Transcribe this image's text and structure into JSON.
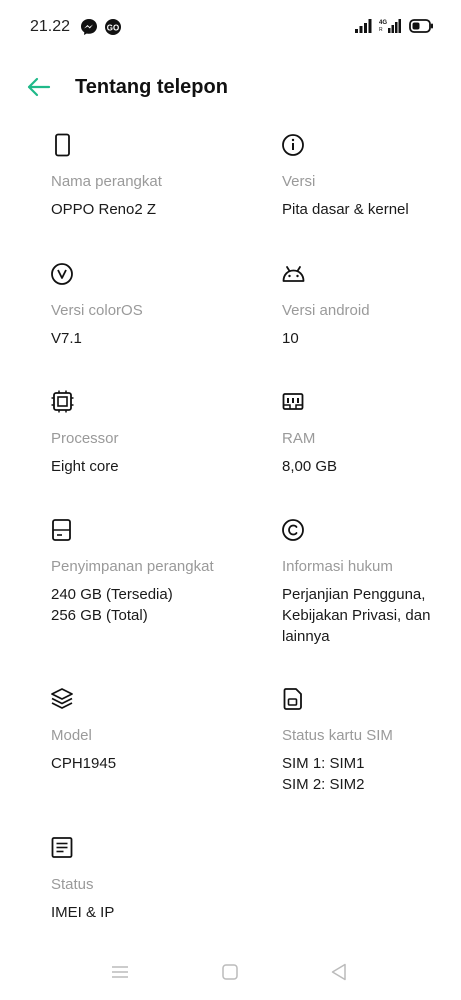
{
  "status_bar": {
    "time": "21.22",
    "left_icons": [
      "messenger-icon",
      "game-controller-icon"
    ],
    "right_icons": [
      "signal-icon",
      "4g-signal-icon",
      "battery-icon"
    ]
  },
  "header": {
    "back_icon": "arrow-left-icon",
    "title": "Tentang telepon",
    "accent_color": "#1fb989"
  },
  "items": [
    {
      "icon": "phone-icon",
      "label": "Nama perangkat",
      "value": "OPPO Reno2 Z"
    },
    {
      "icon": "info-icon",
      "label": "Versi",
      "value": "Pita dasar & kernel"
    },
    {
      "icon": "coloros-icon",
      "label": "Versi colorOS",
      "value": "V7.1"
    },
    {
      "icon": "android-icon",
      "label": "Versi android",
      "value": "10"
    },
    {
      "icon": "processor-icon",
      "label": "Processor",
      "value": "Eight core"
    },
    {
      "icon": "ram-icon",
      "label": "RAM",
      "value": "8,00 GB"
    },
    {
      "icon": "storage-icon",
      "label": "Penyimpanan perangkat",
      "value_lines": [
        "240 GB (Tersedia)",
        "256 GB (Total)"
      ]
    },
    {
      "icon": "copyright-icon",
      "label": "Informasi hukum",
      "value_lines": [
        "Perjanjian Pengguna,",
        "Kebijakan Privasi, dan",
        "lainnya"
      ]
    },
    {
      "icon": "layers-icon",
      "label": "Model",
      "value": "CPH1945"
    },
    {
      "icon": "sim-card-icon",
      "label": "Status kartu SIM",
      "value_lines": [
        "SIM 1: SIM1",
        "SIM 2: SIM2"
      ]
    },
    {
      "icon": "document-icon",
      "label": "Status",
      "value": "IMEI & IP"
    }
  ],
  "nav_bar": {
    "icons": [
      "menu-icon",
      "home-icon",
      "back-icon"
    ]
  }
}
